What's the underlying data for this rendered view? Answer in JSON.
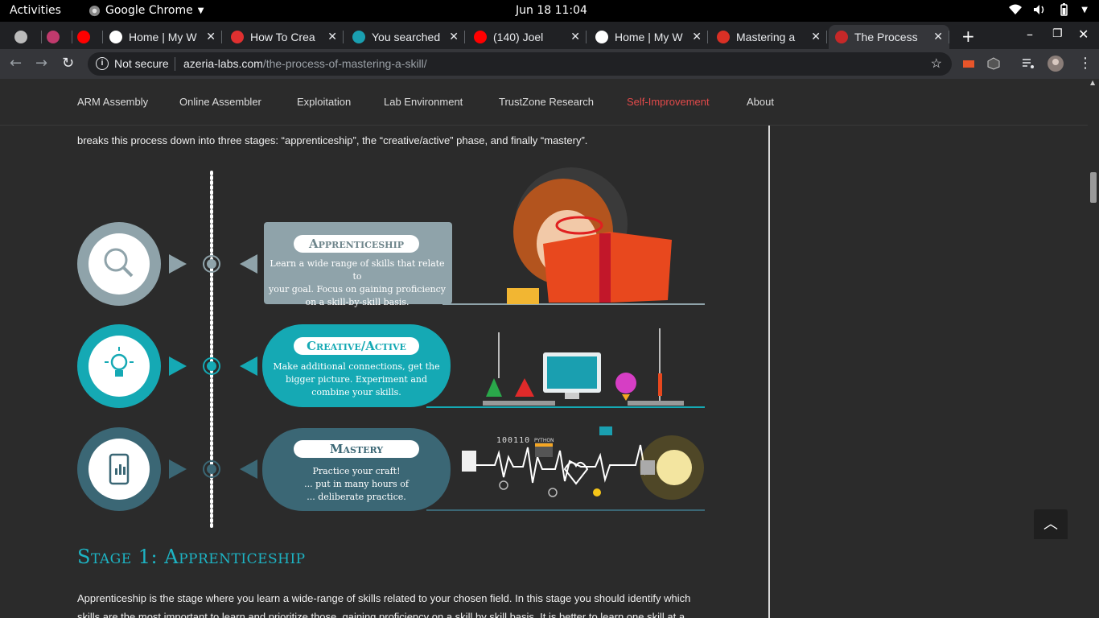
{
  "system_bar": {
    "activities": "Activities",
    "app_name": "Google Chrome",
    "clock": "Jun 18  11:04"
  },
  "tabs": [
    {
      "title": "",
      "favicon": "page-icon",
      "color": "#bbbbbb"
    },
    {
      "title": "",
      "favicon": "opera-icon",
      "color": "#c03a6d"
    },
    {
      "title": "",
      "favicon": "youtube-icon",
      "color": "#ff0000"
    },
    {
      "title": "Home | My W",
      "favicon": "globe-icon",
      "color": "#ffffff"
    },
    {
      "title": "How To Crea",
      "favicon": "seven-icon",
      "color": "#e03030"
    },
    {
      "title": "You searched",
      "favicon": "t-icon",
      "color": "#1a9fb0"
    },
    {
      "title": "(140) Joel",
      "favicon": "youtube-icon",
      "color": "#ff0000"
    },
    {
      "title": "Home | My W",
      "favicon": "globe-icon",
      "color": "#ffffff"
    },
    {
      "title": "Mastering a",
      "favicon": "gmail-icon",
      "color": "#d93025"
    },
    {
      "title": "The Process",
      "favicon": "azeria-icon",
      "color": "#c62828"
    }
  ],
  "omnibox": {
    "security": "Not secure",
    "domain": "azeria-labs.com",
    "path": "/the-process-of-mastering-a-skill/"
  },
  "site_menu": [
    "ARM Assembly",
    "Online Assembler",
    "Exploitation",
    "Lab Environment",
    "TrustZone Research",
    "Self-Improvement",
    "About"
  ],
  "intro_line": "breaks this process down into three stages: “apprenticeship”, the “creative/active” phase, and finally “mastery”.",
  "stages": [
    {
      "title": "Apprenticeship",
      "text": [
        "Learn a wide range of skills that relate to",
        "your goal. Focus on gaining proficiency",
        "on a skill-by-skill basis."
      ],
      "color": "#8fa3aa",
      "icon": "magnifier-icon"
    },
    {
      "title": "Creative/Active",
      "text": [
        "Make additional connections, get the",
        "bigger picture. Experiment and",
        "combine your skills."
      ],
      "color": "#15a9b4",
      "icon": "lightbulb-icon"
    },
    {
      "title": "Mastery",
      "text": [
        "Practice your craft!",
        "... put in many hours of",
        "... deliberate practice."
      ],
      "color": "#3b6775",
      "icon": "tablet-icon"
    }
  ],
  "mastery_art": {
    "binary": "100110",
    "code_label": "PYTHON"
  },
  "section_heading": "Stage 1: Apprenticeship",
  "body_text": [
    "Apprenticeship is the stage where you learn a wide-range of skills related to your chosen field. In this stage you should identify which",
    "skills are the most important to learn and prioritize those, gaining proficiency on a skill by skill basis. It is better to learn one skill at a"
  ]
}
